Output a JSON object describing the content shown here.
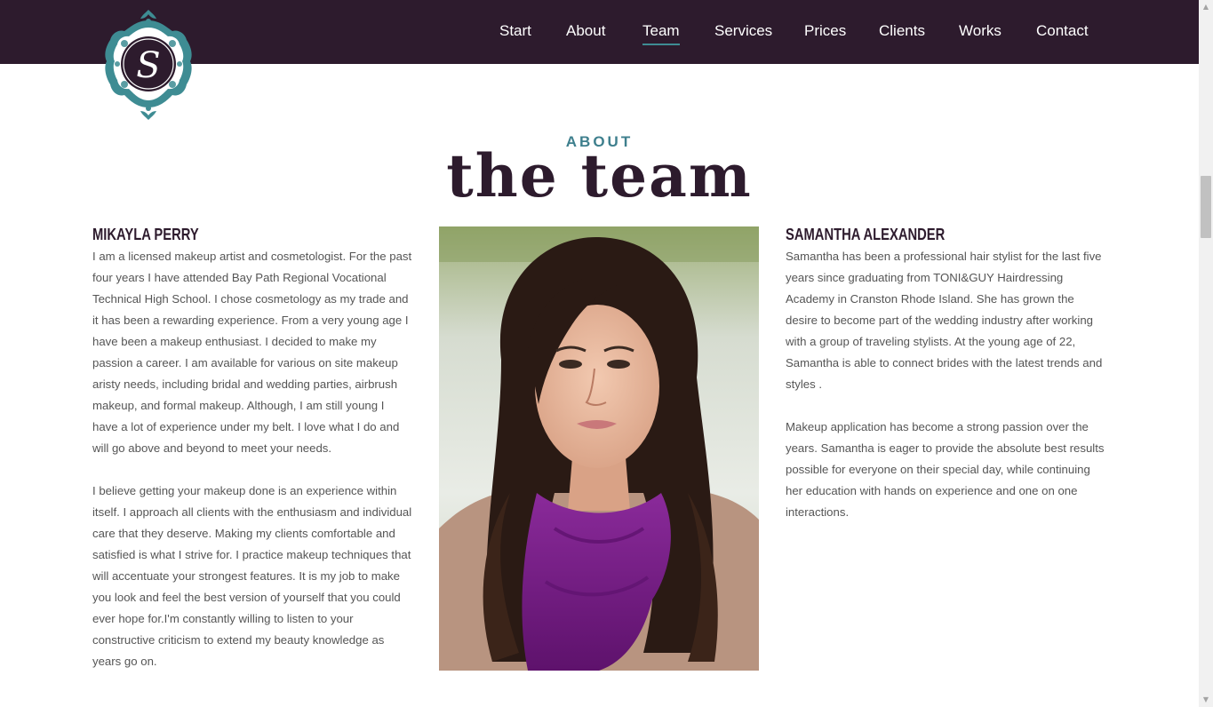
{
  "nav": {
    "items": [
      {
        "label": "Start"
      },
      {
        "label": "About"
      },
      {
        "label": "Team"
      },
      {
        "label": "Services"
      },
      {
        "label": "Prices"
      },
      {
        "label": "Clients"
      },
      {
        "label": "Works"
      },
      {
        "label": "Contact"
      }
    ],
    "active": "Team"
  },
  "logo": {
    "monogram": "S",
    "icon": "ornamental-monogram-logo"
  },
  "heading": {
    "kicker": "ABOUT",
    "title": "the team"
  },
  "members": [
    {
      "name": "MIKAYLA PERRY",
      "paragraphs": [
        "I am a licensed makeup artist and cosmetologist. For the past four years I have attended Bay Path Regional Vocational Technical High School. I chose cosmetology as my trade and it has been a rewarding experience. From a very young age I have been a makeup enthusiast. I decided to make my passion a career. I am available for various on site makeup aristy needs, including bridal and wedding parties, airbrush makeup, and formal makeup. Although, I am still young I have a lot of experience under my belt. I love what I do and will go above and beyond to meet your needs.",
        "I believe getting your makeup done is an experience within itself. I approach all clients with the enthusiasm and individual care that they deserve. Making my clients comfortable and satisfied is what I strive for. I practice makeup techniques that will accentuate your strongest features. It is my job to make you look and feel the best version of yourself that you could ever hope for.I'm constantly willing to listen to your constructive criticism to extend my beauty knowledge as years go on."
      ]
    },
    {
      "name": "SAMANTHA ALEXANDER",
      "paragraphs": [
        "Samantha has been a professional hair stylist for the last five years since graduating from TONI&GUY Hairdressing Academy in Cranston Rhode Island. She has grown the desire to become part of the wedding industry after working with a group of traveling stylists. At the young age of 22, Samantha is able to connect brides with the latest trends and styles .",
        "Makeup application has become a strong passion over the years. Samantha is eager to provide the absolute best results possible for everyone on their special day, while continuing her education with hands on experience and one on one interactions."
      ]
    }
  ],
  "colors": {
    "nav_bg": "#2d1b2d",
    "accent_teal": "#3e8c93",
    "heading_plum": "#2d1b2d",
    "body_text": "#555555",
    "scarf_purple": "#7a1f8a"
  }
}
